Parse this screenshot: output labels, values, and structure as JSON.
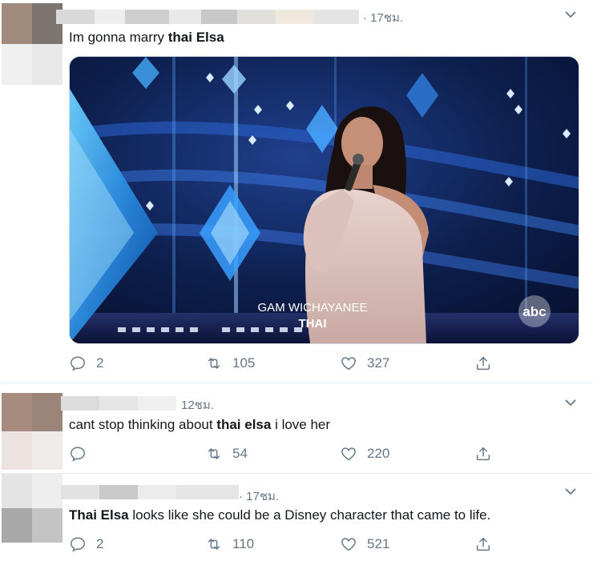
{
  "tweets": [
    {
      "time": "· 17ชม.",
      "text_before": "Im gonna marry ",
      "text_bold": "thai Elsa",
      "text_after": "",
      "reply_count": "2",
      "retweet_count": "105",
      "like_count": "327",
      "media": {
        "caption_name": "GAM WICHAYANEE",
        "caption_country": "THAI",
        "network_logo": "abc"
      }
    },
    {
      "time": "12ชม.",
      "text_before": "cant stop thinking about ",
      "text_bold": "thai elsa",
      "text_after": " i love her",
      "reply_count": "",
      "retweet_count": "54",
      "like_count": "220"
    },
    {
      "time": "· 17ชม.",
      "text_before": "",
      "text_bold": "Thai Elsa",
      "text_after": " looks like she could be a Disney character that came to life.",
      "reply_count": "2",
      "retweet_count": "110",
      "like_count": "521"
    }
  ],
  "icons": {
    "reply": "reply-icon",
    "retweet": "retweet-icon",
    "like": "heart-icon",
    "share": "share-icon",
    "more": "chevron-down-icon"
  },
  "colors": {
    "text": "#14171a",
    "secondary": "#657786",
    "divider": "#e6ecf0"
  }
}
